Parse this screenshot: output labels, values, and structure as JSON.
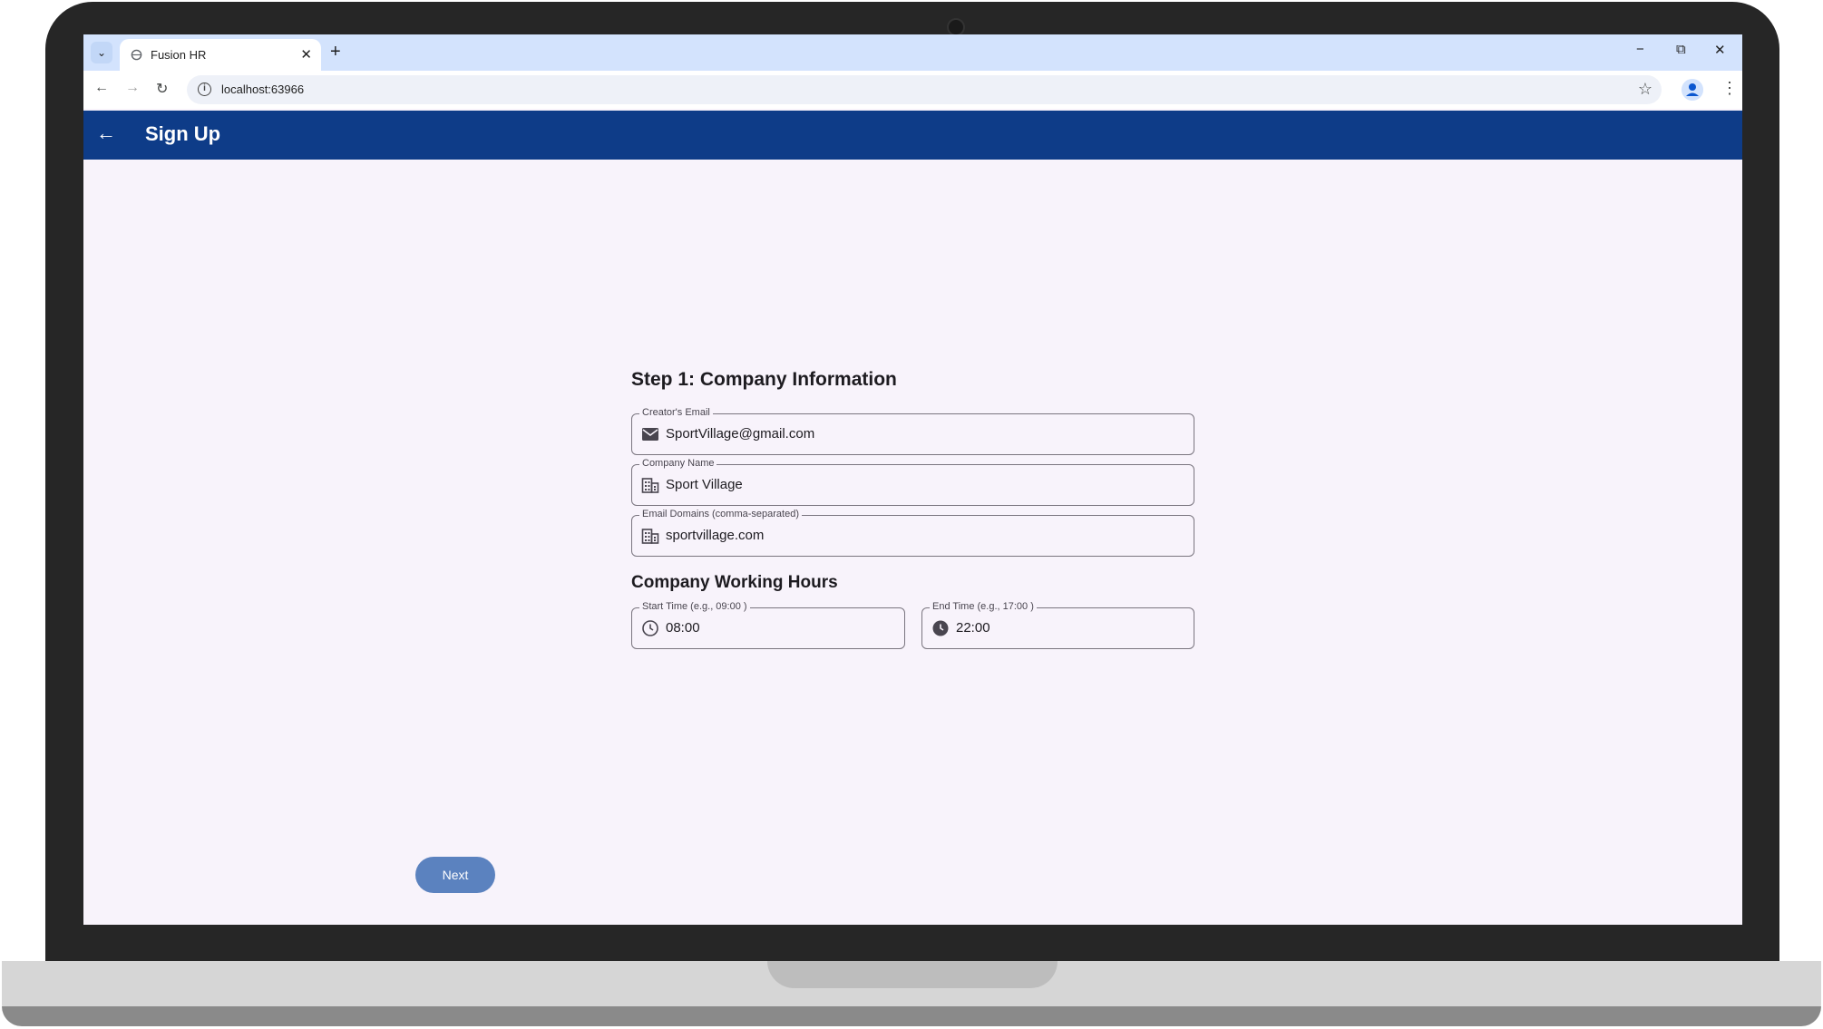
{
  "browser": {
    "tab_title": "Fusion HR",
    "url": "localhost:63966",
    "window_controls": {
      "minimize": "−",
      "restore": "⧉",
      "close": "✕"
    }
  },
  "appbar": {
    "title": "Sign Up",
    "back_icon": "arrow-back-icon"
  },
  "form": {
    "step_title": "Step 1: Company Information",
    "fields": [
      {
        "label": "Creator's Email",
        "value": "SportVillage@gmail.com",
        "icon": "mail-icon"
      },
      {
        "label": "Company Name",
        "value": "Sport Village",
        "icon": "building-icon"
      },
      {
        "label": "Email Domains (comma-separated)",
        "value": "sportvillage.com",
        "icon": "building-icon"
      }
    ],
    "hours_title": "Company Working Hours",
    "start_time": {
      "label": "Start Time (e.g., 09:00 )",
      "value": "08:00",
      "icon": "clock-outline-icon"
    },
    "end_time": {
      "label": "End Time (e.g., 17:00 )",
      "value": "22:00",
      "icon": "clock-filled-icon"
    },
    "next_label": "Next"
  },
  "colors": {
    "appbar": "#0e3c88",
    "background": "#f8f3fb",
    "button": "#5b82bf"
  }
}
